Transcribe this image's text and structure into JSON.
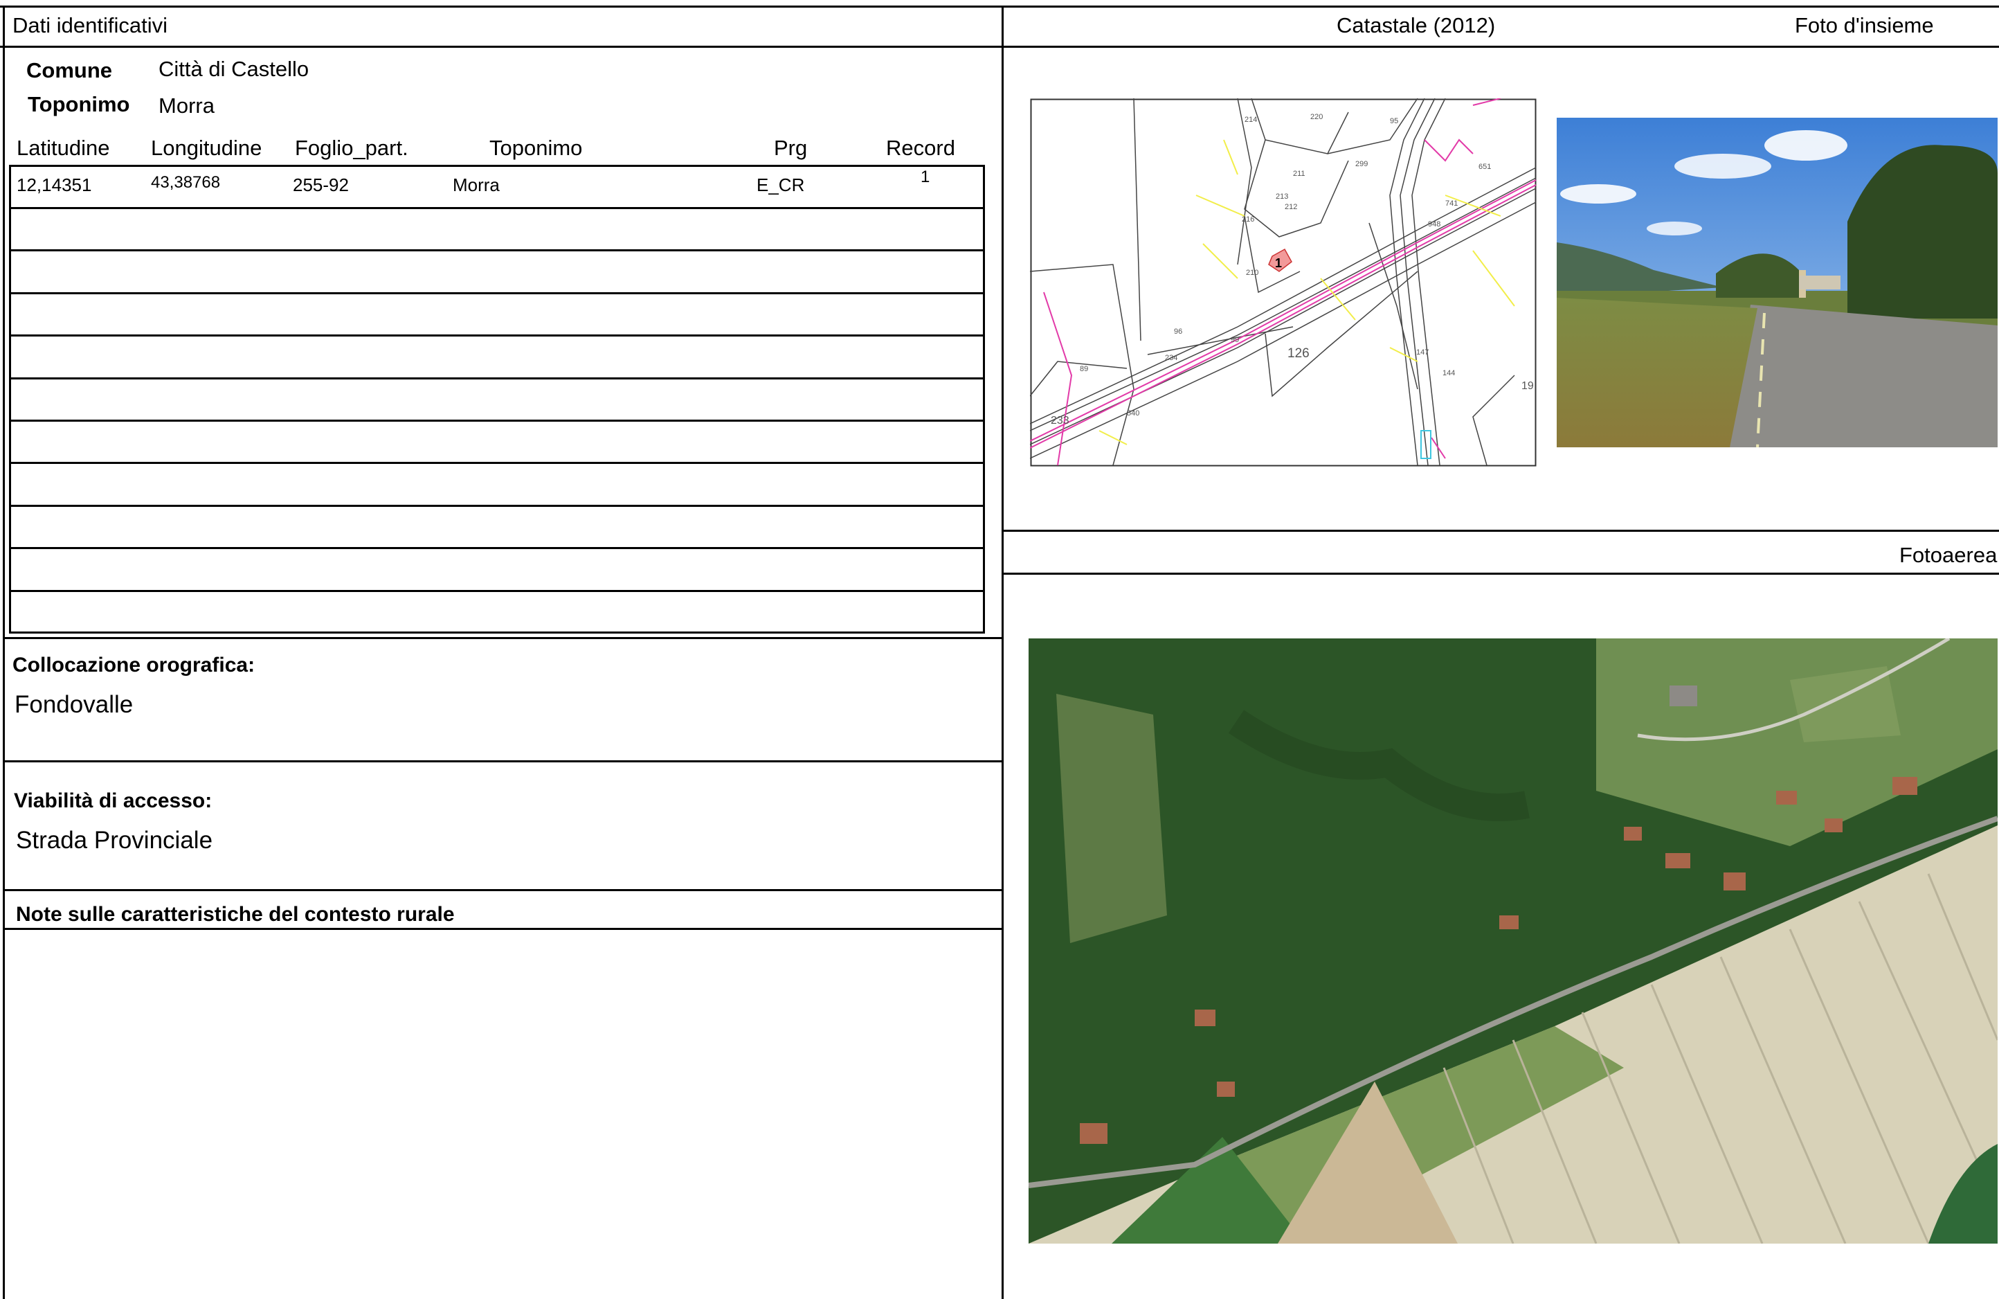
{
  "left": {
    "section_title": "Dati identificativi",
    "comune_label": "Comune",
    "comune_value": "Città di Castello",
    "toponimo_label": "Toponimo",
    "toponimo_value": "Morra",
    "table": {
      "columns": [
        "Latitudine",
        "Longitudine",
        "Foglio_part.",
        "Toponimo",
        "Prg",
        "Record"
      ],
      "rows": [
        [
          "12,14351",
          "43,38768",
          "255-92",
          "Morra",
          "E_CR",
          "1"
        ]
      ],
      "empty_rows": 10
    },
    "orografia_label": "Collocazione orografica:",
    "orografia_value": "Fondovalle",
    "viabilita_label": "Viabilità di accesso:",
    "viabilita_value": "Strada Provinciale",
    "note_label": "Note sulle caratteristiche del contesto rurale"
  },
  "right": {
    "catastale_title": "Catastale (2012)",
    "foto_title": "Foto d'insieme",
    "fotoaerea_title": "Fotoaerea",
    "map_labels": [
      "214",
      "220",
      "95",
      "299",
      "211",
      "212",
      "213",
      "216",
      "210",
      "1",
      "233",
      "126",
      "96",
      "89",
      "234",
      "99",
      "147",
      "144",
      "19",
      "633",
      "540",
      "651",
      "741",
      "948"
    ],
    "marker_label": "1"
  },
  "colors": {
    "cadastral_pink": "#e23aa8",
    "cadastral_yellow": "#f2ee4a",
    "sky_blue": "#3d7fd6",
    "forest_green": "#2f5a2a",
    "field_beige": "#d8d2b8"
  }
}
